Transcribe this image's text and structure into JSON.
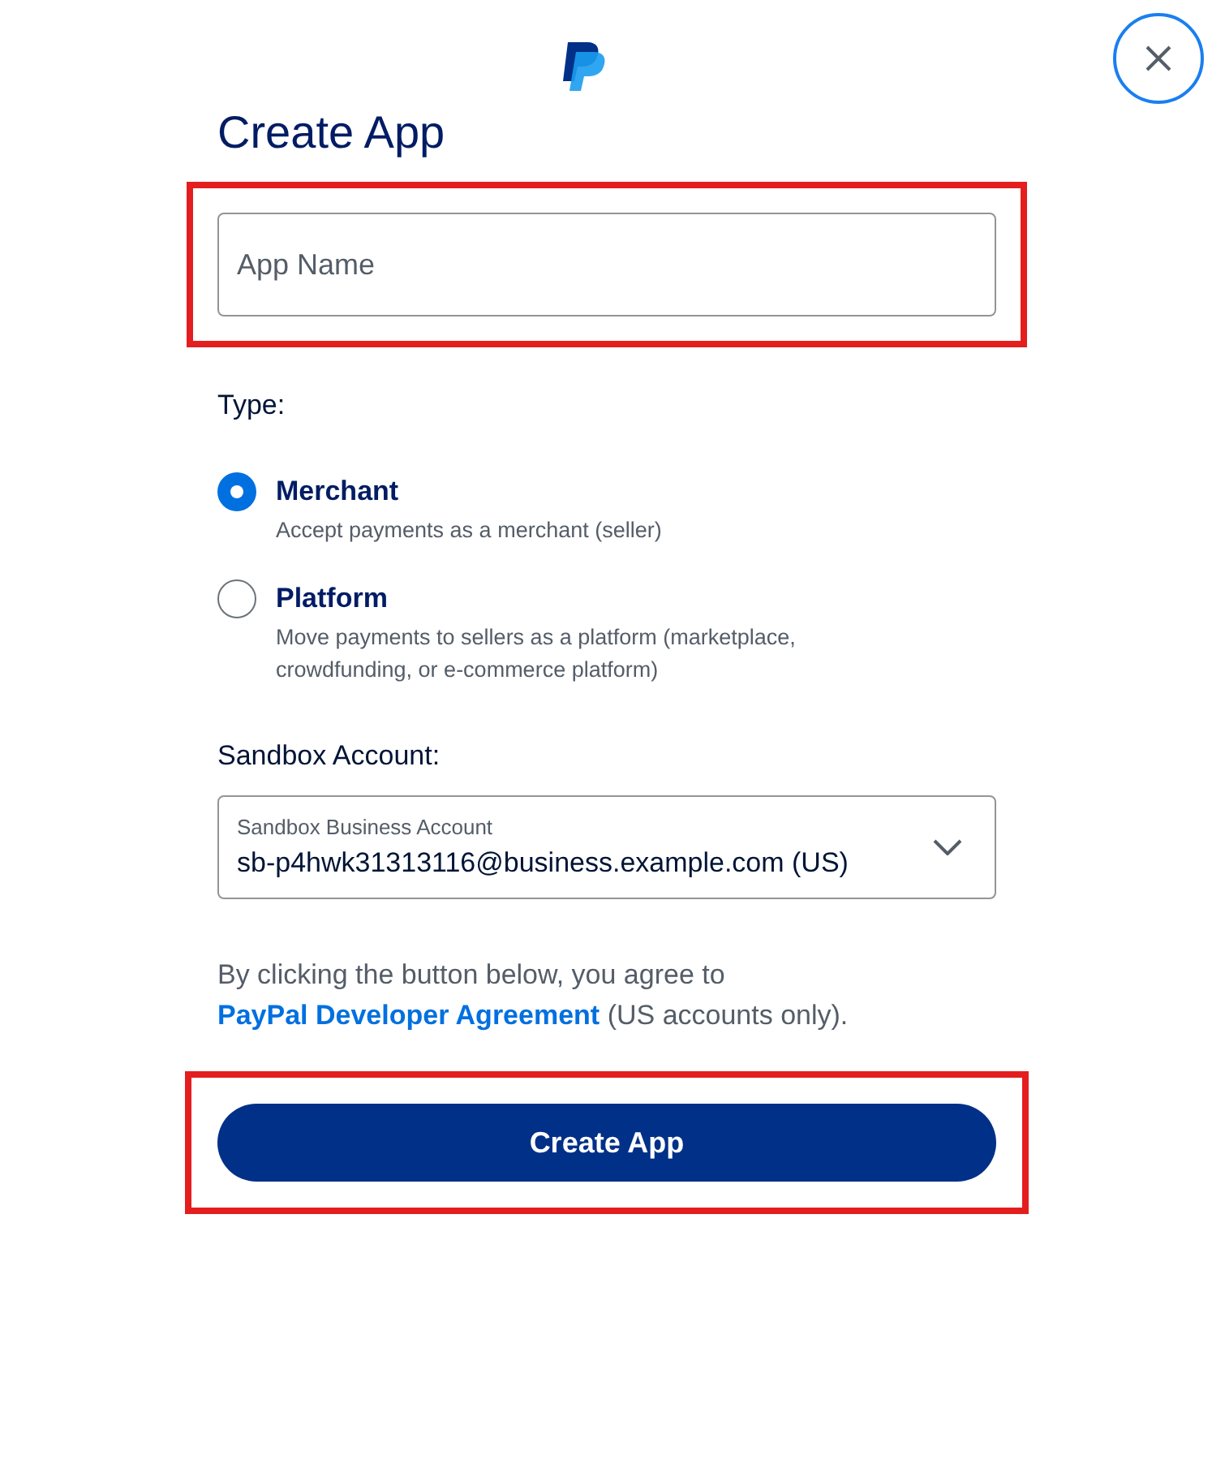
{
  "title": "Create App",
  "app_name": {
    "placeholder": "App Name",
    "highlighted": true
  },
  "type_label": "Type:",
  "types": [
    {
      "label": "Merchant",
      "description": "Accept payments as a merchant (seller)",
      "selected": true
    },
    {
      "label": "Platform",
      "description": "Move payments to sellers as a platform (marketplace, crowdfunding, or e-commerce platform)",
      "selected": false
    }
  ],
  "sandbox_label": "Sandbox Account:",
  "sandbox_select": {
    "label": "Sandbox Business Account",
    "value": "sb-p4hwk31313116@business.example.com (US)"
  },
  "agreement": {
    "before": "By clicking the button below, you agree to",
    "link": "PayPal Developer Agreement",
    "after": "(US accounts only)."
  },
  "submit": {
    "label": "Create App",
    "highlighted": true
  }
}
